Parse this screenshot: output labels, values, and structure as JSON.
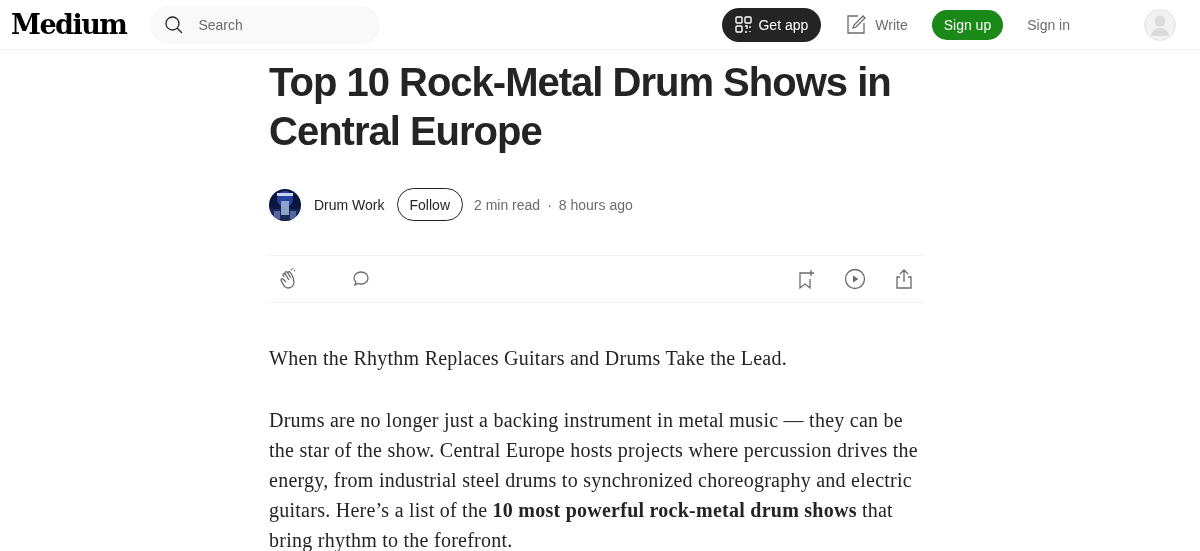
{
  "header": {
    "logo": "Medium",
    "search": {
      "placeholder": "Search"
    },
    "get_app": "Get app",
    "write": "Write",
    "sign_up": "Sign up",
    "sign_in": "Sign in"
  },
  "article": {
    "title": "Top 10 Rock-Metal Drum Shows in Central Europe",
    "author": {
      "name": "Drum Work"
    },
    "follow": "Follow",
    "read_time": "2 min read",
    "separator": "·",
    "posted": "8 hours ago",
    "paragraphs": [
      "When the Rhythm Replaces Guitars and Drums Take the Lead.",
      "Drums are no longer just a backing instrument in metal music — they can be the star of the show. Central Europe hosts projects where percussion drives the energy, from industrial steel drums to synchronized choreography and electric guitars. Here’s a list of the **10 most powerful rock-metal drum shows** that bring rhythm to the forefront."
    ]
  }
}
